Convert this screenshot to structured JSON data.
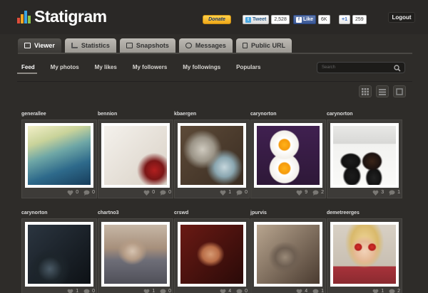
{
  "header": {
    "logo": "Statigram",
    "donate_label": "Donate",
    "tweet": {
      "label": "Tweet",
      "count": "2,528"
    },
    "like": {
      "label": "Like",
      "count": "6K"
    },
    "gplus": {
      "label": "+1",
      "count": "259"
    },
    "logout_label": "Logout"
  },
  "tabs": [
    {
      "label": "Viewer",
      "icon": "viewer-icon",
      "active": true
    },
    {
      "label": "Statistics",
      "icon": "statistics-icon"
    },
    {
      "label": "Snapshots",
      "icon": "snapshots-icon"
    },
    {
      "label": "Messages",
      "icon": "messages-icon"
    },
    {
      "label": "Public URL",
      "icon": "lock-icon"
    }
  ],
  "subnav": [
    {
      "label": "Feed",
      "active": true
    },
    {
      "label": "My photos"
    },
    {
      "label": "My likes"
    },
    {
      "label": "My followers"
    },
    {
      "label": "My followings"
    },
    {
      "label": "Populars"
    }
  ],
  "search": {
    "placeholder": "Search"
  },
  "photos": [
    {
      "user": "generallee",
      "likes": "0",
      "comments": "0"
    },
    {
      "user": "bennion",
      "likes": "0",
      "comments": "0"
    },
    {
      "user": "kbaergen",
      "likes": "1",
      "comments": "0"
    },
    {
      "user": "carynorton",
      "likes": "9",
      "comments": "2"
    },
    {
      "user": "carynorton",
      "likes": "3",
      "comments": "1"
    },
    {
      "user": "carynorton",
      "likes": "1",
      "comments": "0"
    },
    {
      "user": "chartno3",
      "likes": "1",
      "comments": "0"
    },
    {
      "user": "crswd",
      "likes": "4",
      "comments": "0"
    },
    {
      "user": "jpurvis",
      "likes": "4",
      "comments": "1"
    },
    {
      "user": "demetreerges",
      "likes": "1",
      "comments": "2"
    }
  ],
  "colors": {
    "background": "#2e2c29",
    "tab_active": "#3b3936",
    "tab_inactive": "#b0ada7",
    "donate": "#f5b52a"
  }
}
